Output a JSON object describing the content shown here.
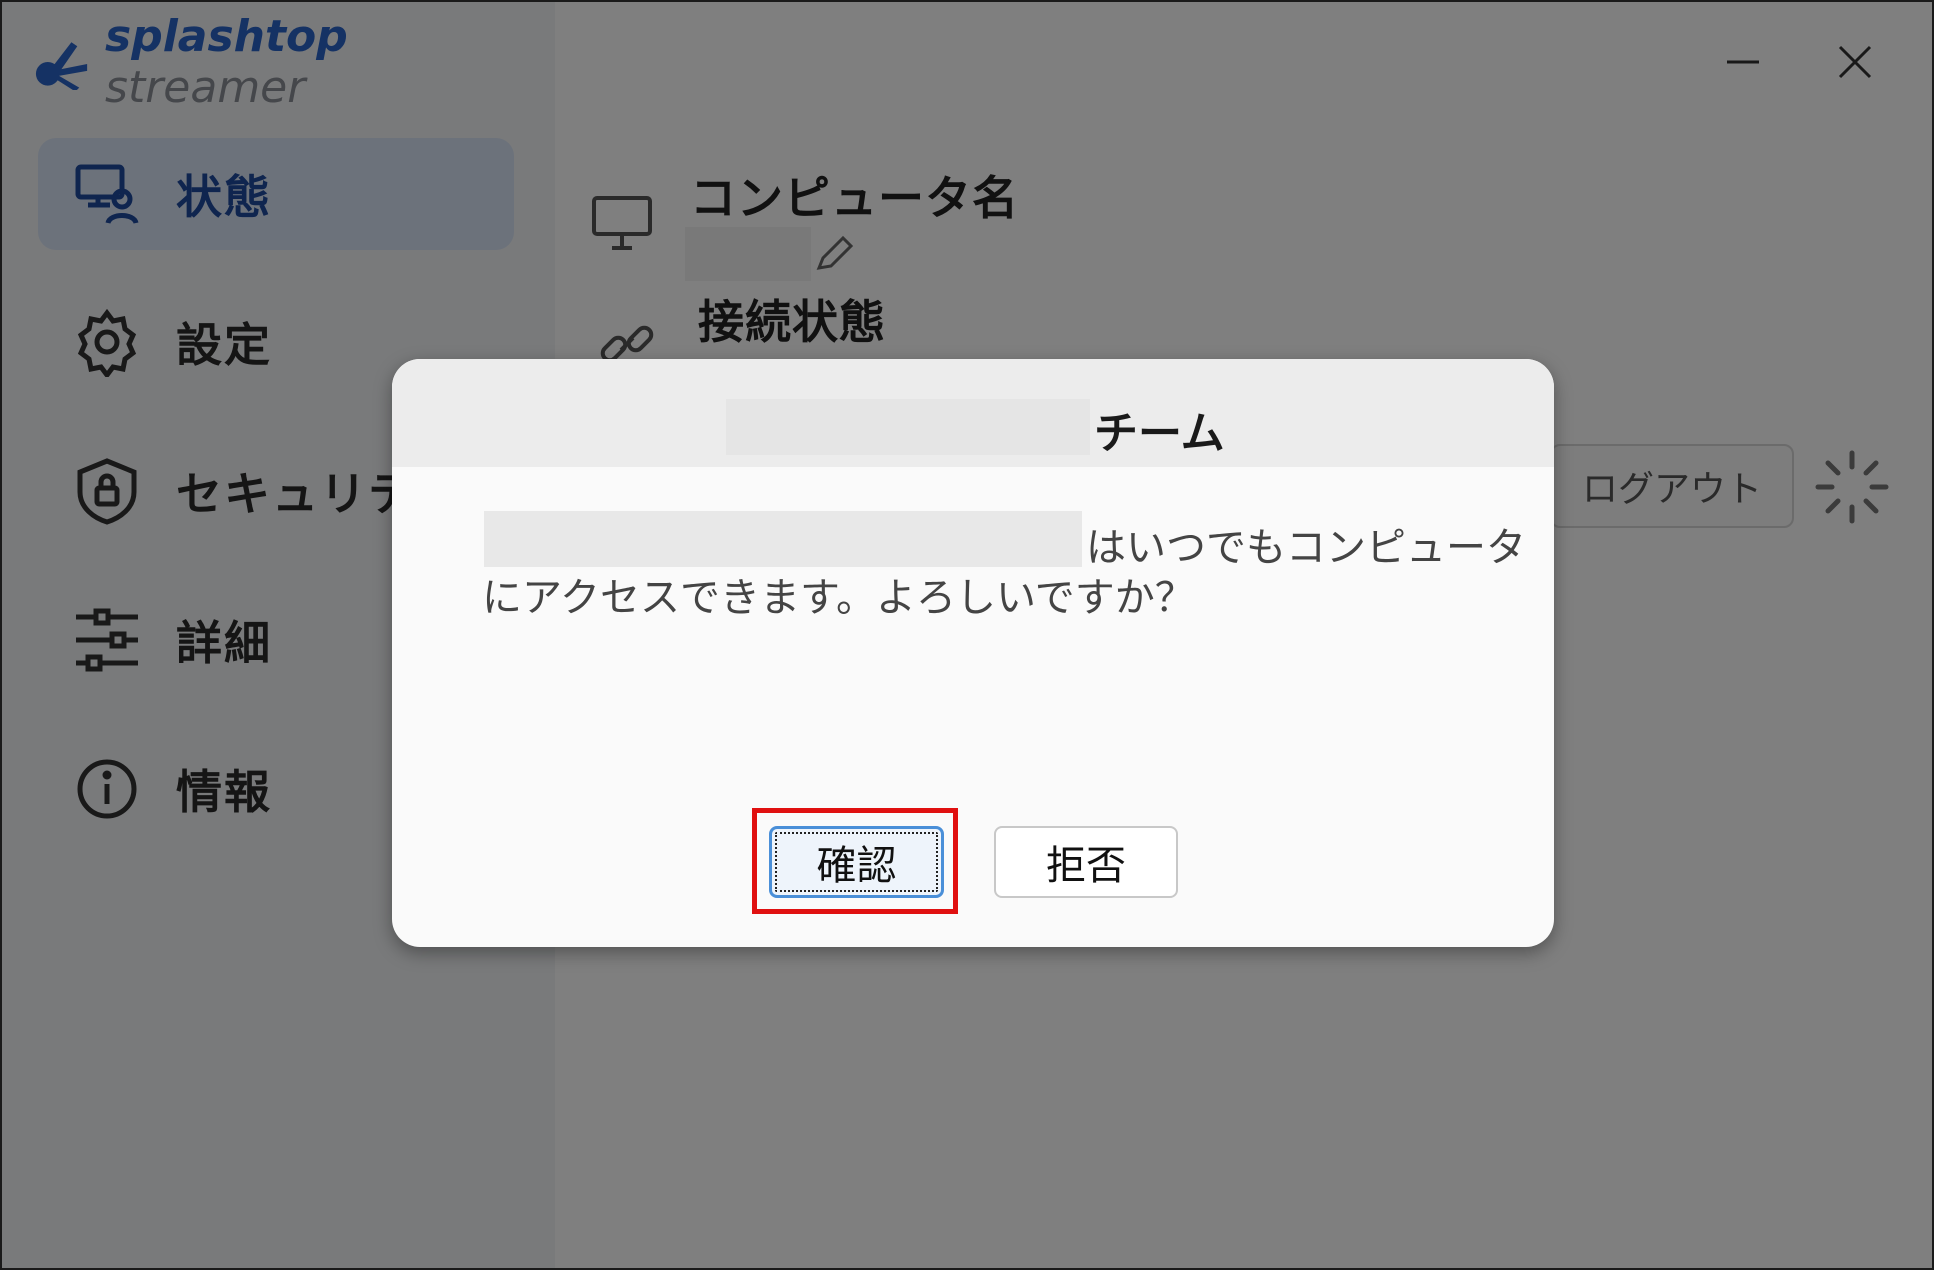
{
  "app": {
    "logo_bold": "splashtop",
    "logo_light": "streamer"
  },
  "sidebar": {
    "items": [
      {
        "label": "状態",
        "icon": "monitor-user-icon",
        "active": true
      },
      {
        "label": "設定",
        "icon": "gear-icon",
        "active": false
      },
      {
        "label": "セキュリティ",
        "icon": "shield-lock-icon",
        "active": false
      },
      {
        "label": "詳細",
        "icon": "sliders-icon",
        "active": false
      },
      {
        "label": "情報",
        "icon": "info-icon",
        "active": false
      }
    ]
  },
  "main": {
    "computer_name_label": "コンピュータ名",
    "connection_status_label": "接続状態",
    "logout_label": "ログアウト"
  },
  "dialog": {
    "title_suffix": "チーム",
    "message_line1": "はいつでもコンピュータ",
    "message_line2": "にアクセスできます。よろしいですか？",
    "confirm_label": "確認",
    "reject_label": "拒否"
  },
  "colors": {
    "accent": "#2b65c9",
    "highlight": "#e01010",
    "overlay": "rgba(0,0,0,0.5)"
  }
}
